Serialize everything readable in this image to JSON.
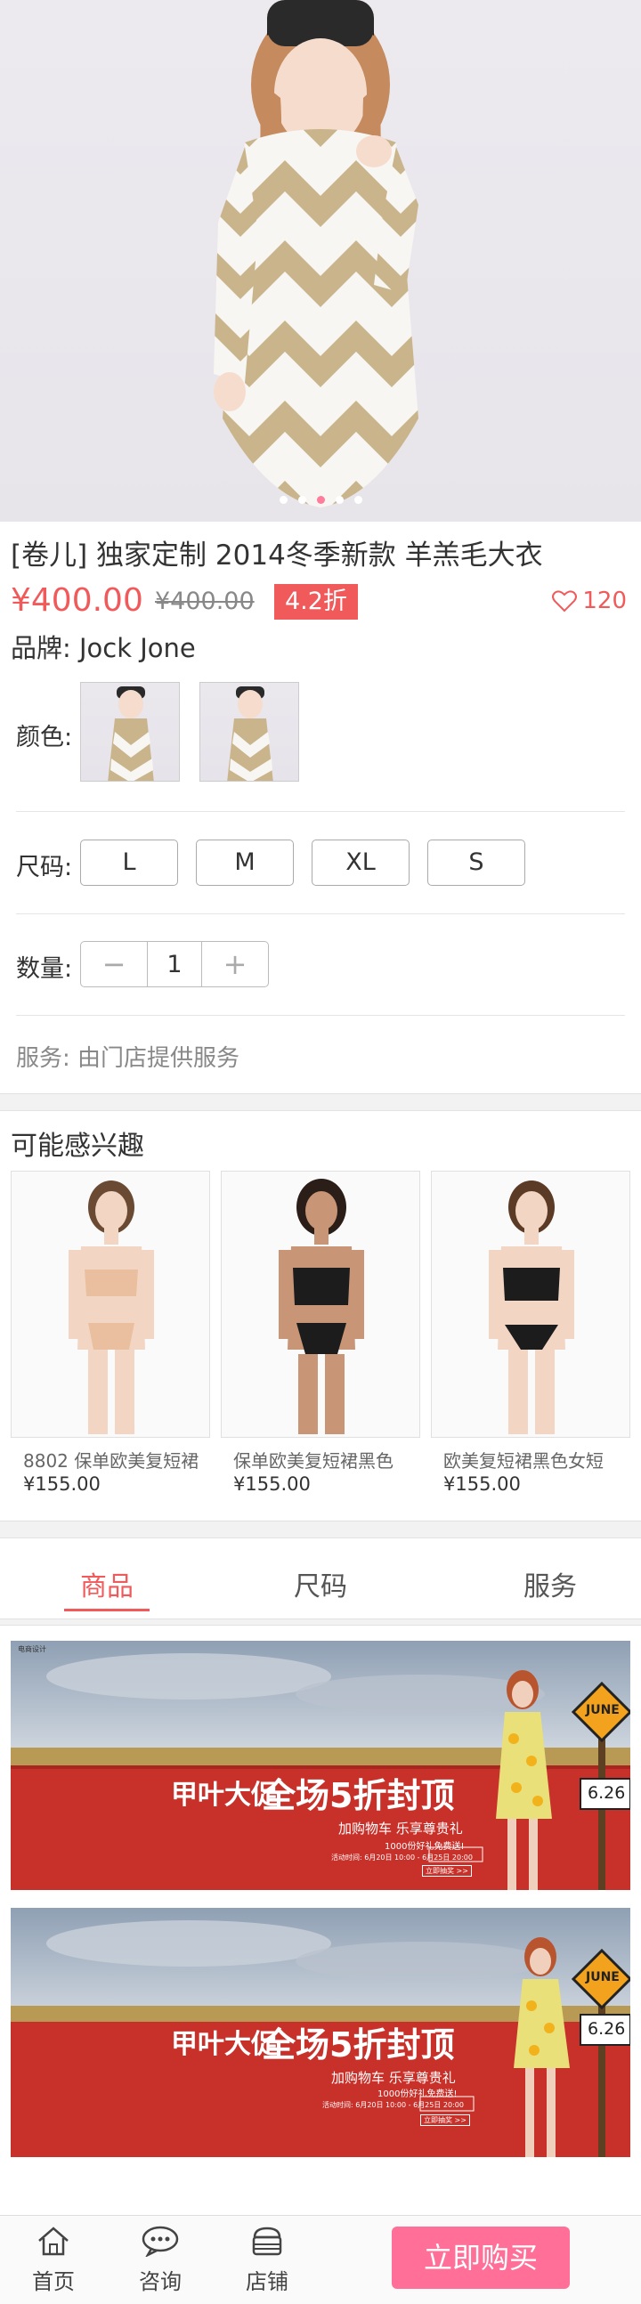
{
  "product": {
    "title": "[卷儿] 独家定制 2014冬季新款 羊羔毛大衣",
    "price": "¥400.00",
    "old_price": "¥400.00",
    "discount": "4.2折",
    "favorites": "120",
    "brand": "品牌: Jock Jone"
  },
  "gallery": {
    "slide_count": 5,
    "active_slide": 3
  },
  "options": {
    "color_label": "颜色:",
    "size_label": "尺码:",
    "sizes": [
      "L",
      "M",
      "XL",
      "S"
    ],
    "quantity_label": "数量:",
    "quantity": "1",
    "minus": "−",
    "plus": "+",
    "service": "服务: 由门店提供服务"
  },
  "recommend": {
    "title": "可能感兴趣",
    "items": [
      {
        "name": "8802 保单欧美复短裙",
        "price": "¥155.00"
      },
      {
        "name": "保单欧美复短裙黑色",
        "price": "¥155.00"
      },
      {
        "name": "欧美复短裙黑色女短",
        "price": "¥155.00"
      }
    ]
  },
  "tabs": [
    "商品",
    "尺码",
    "服务"
  ],
  "banner": {
    "brand": "甲叶大促",
    "headline": "全场5折封顶",
    "subline": "加购物车 乐享尊贵礼",
    "note": "1000份好礼免费送!",
    "date_text": "活动时间: 6月20日 10:00 - 6月25日 20:00",
    "button": "立即抽奖 >>",
    "sign": "JUNE",
    "sign_date": "6.26",
    "corner_text": "电商设计"
  },
  "bottom_bar": {
    "home": "首页",
    "consult": "咨询",
    "shop": "店铺",
    "buy": "立即购买"
  },
  "colors": {
    "accent": "#f05a5a",
    "buy_button": "#ff6f98",
    "banner_red": "#c8302a"
  }
}
